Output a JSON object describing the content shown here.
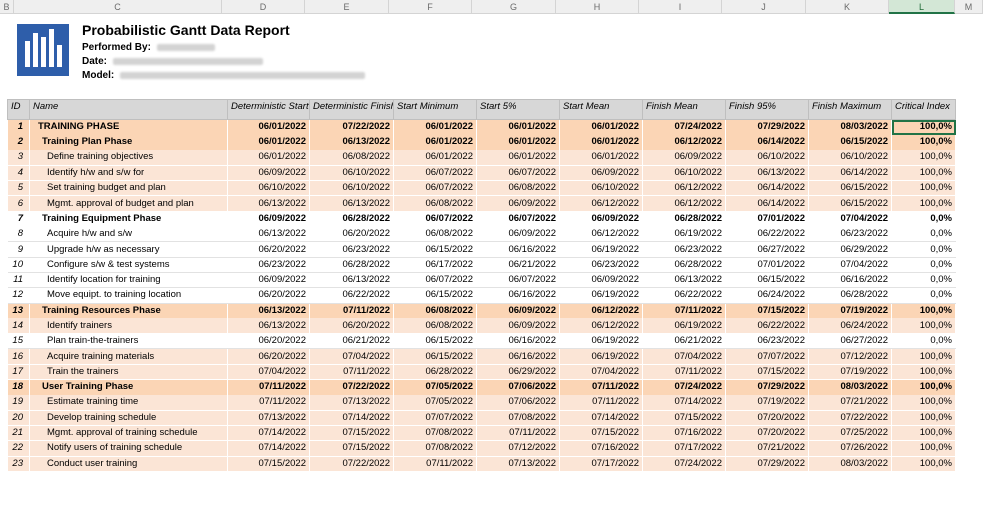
{
  "col_letters": [
    "B",
    "C",
    "D",
    "E",
    "F",
    "G",
    "H",
    "I",
    "J",
    "K",
    "L",
    "M"
  ],
  "report": {
    "title": "Probabilistic Gantt Data Report",
    "performed_by_label": "Performed By:",
    "date_label": "Date:",
    "model_label": "Model:"
  },
  "columns": [
    "ID",
    "Name",
    "Deterministic Start",
    "Deterministic Finish",
    "Start Minimum",
    "Start 5%",
    "Start Mean",
    "Finish Mean",
    "Finish 95%",
    "Finish Maximum",
    "Critical Index"
  ],
  "rows": [
    {
      "id": "1",
      "name": "TRAINING PHASE",
      "ds": "06/01/2022",
      "df": "07/22/2022",
      "smin": "06/01/2022",
      "s5": "06/01/2022",
      "smean": "06/01/2022",
      "fmean": "07/24/2022",
      "f95": "07/29/2022",
      "fmax": "08/03/2022",
      "ci": "100,0%"
    },
    {
      "id": "2",
      "name": "Training Plan Phase",
      "ds": "06/01/2022",
      "df": "06/13/2022",
      "smin": "06/01/2022",
      "s5": "06/01/2022",
      "smean": "06/01/2022",
      "fmean": "06/12/2022",
      "f95": "06/14/2022",
      "fmax": "06/15/2022",
      "ci": "100,0%"
    },
    {
      "id": "3",
      "name": "Define training objectives",
      "ds": "06/01/2022",
      "df": "06/08/2022",
      "smin": "06/01/2022",
      "s5": "06/01/2022",
      "smean": "06/01/2022",
      "fmean": "06/09/2022",
      "f95": "06/10/2022",
      "fmax": "06/10/2022",
      "ci": "100,0%"
    },
    {
      "id": "4",
      "name": "Identify h/w and s/w for",
      "ds": "06/09/2022",
      "df": "06/10/2022",
      "smin": "06/07/2022",
      "s5": "06/07/2022",
      "smean": "06/09/2022",
      "fmean": "06/10/2022",
      "f95": "06/13/2022",
      "fmax": "06/14/2022",
      "ci": "100,0%"
    },
    {
      "id": "5",
      "name": "Set training budget and plan",
      "ds": "06/10/2022",
      "df": "06/10/2022",
      "smin": "06/07/2022",
      "s5": "06/08/2022",
      "smean": "06/10/2022",
      "fmean": "06/12/2022",
      "f95": "06/14/2022",
      "fmax": "06/15/2022",
      "ci": "100,0%"
    },
    {
      "id": "6",
      "name": "Mgmt. approval of budget and plan",
      "ds": "06/13/2022",
      "df": "06/13/2022",
      "smin": "06/08/2022",
      "s5": "06/09/2022",
      "smean": "06/12/2022",
      "fmean": "06/12/2022",
      "f95": "06/14/2022",
      "fmax": "06/15/2022",
      "ci": "100,0%"
    },
    {
      "id": "7",
      "name": "Training Equipment Phase",
      "ds": "06/09/2022",
      "df": "06/28/2022",
      "smin": "06/07/2022",
      "s5": "06/07/2022",
      "smean": "06/09/2022",
      "fmean": "06/28/2022",
      "f95": "07/01/2022",
      "fmax": "07/04/2022",
      "ci": "0,0%"
    },
    {
      "id": "8",
      "name": "Acquire h/w and s/w",
      "ds": "06/13/2022",
      "df": "06/20/2022",
      "smin": "06/08/2022",
      "s5": "06/09/2022",
      "smean": "06/12/2022",
      "fmean": "06/19/2022",
      "f95": "06/22/2022",
      "fmax": "06/23/2022",
      "ci": "0,0%"
    },
    {
      "id": "9",
      "name": "Upgrade h/w as necessary",
      "ds": "06/20/2022",
      "df": "06/23/2022",
      "smin": "06/15/2022",
      "s5": "06/16/2022",
      "smean": "06/19/2022",
      "fmean": "06/23/2022",
      "f95": "06/27/2022",
      "fmax": "06/29/2022",
      "ci": "0,0%"
    },
    {
      "id": "10",
      "name": "Configure s/w & test systems",
      "ds": "06/23/2022",
      "df": "06/28/2022",
      "smin": "06/17/2022",
      "s5": "06/21/2022",
      "smean": "06/23/2022",
      "fmean": "06/28/2022",
      "f95": "07/01/2022",
      "fmax": "07/04/2022",
      "ci": "0,0%"
    },
    {
      "id": "11",
      "name": "Identify location for training",
      "ds": "06/09/2022",
      "df": "06/13/2022",
      "smin": "06/07/2022",
      "s5": "06/07/2022",
      "smean": "06/09/2022",
      "fmean": "06/13/2022",
      "f95": "06/15/2022",
      "fmax": "06/16/2022",
      "ci": "0,0%"
    },
    {
      "id": "12",
      "name": "Move equipt. to training location",
      "ds": "06/20/2022",
      "df": "06/22/2022",
      "smin": "06/15/2022",
      "s5": "06/16/2022",
      "smean": "06/19/2022",
      "fmean": "06/22/2022",
      "f95": "06/24/2022",
      "fmax": "06/28/2022",
      "ci": "0,0%"
    },
    {
      "id": "13",
      "name": "Training Resources Phase",
      "ds": "06/13/2022",
      "df": "07/11/2022",
      "smin": "06/08/2022",
      "s5": "06/09/2022",
      "smean": "06/12/2022",
      "fmean": "07/11/2022",
      "f95": "07/15/2022",
      "fmax": "07/19/2022",
      "ci": "100,0%"
    },
    {
      "id": "14",
      "name": "Identify trainers",
      "ds": "06/13/2022",
      "df": "06/20/2022",
      "smin": "06/08/2022",
      "s5": "06/09/2022",
      "smean": "06/12/2022",
      "fmean": "06/19/2022",
      "f95": "06/22/2022",
      "fmax": "06/24/2022",
      "ci": "100,0%"
    },
    {
      "id": "15",
      "name": "Plan train-the-trainers",
      "ds": "06/20/2022",
      "df": "06/21/2022",
      "smin": "06/15/2022",
      "s5": "06/16/2022",
      "smean": "06/19/2022",
      "fmean": "06/21/2022",
      "f95": "06/23/2022",
      "fmax": "06/27/2022",
      "ci": "0,0%"
    },
    {
      "id": "16",
      "name": "Acquire training materials",
      "ds": "06/20/2022",
      "df": "07/04/2022",
      "smin": "06/15/2022",
      "s5": "06/16/2022",
      "smean": "06/19/2022",
      "fmean": "07/04/2022",
      "f95": "07/07/2022",
      "fmax": "07/12/2022",
      "ci": "100,0%"
    },
    {
      "id": "17",
      "name": "Train the trainers",
      "ds": "07/04/2022",
      "df": "07/11/2022",
      "smin": "06/28/2022",
      "s5": "06/29/2022",
      "smean": "07/04/2022",
      "fmean": "07/11/2022",
      "f95": "07/15/2022",
      "fmax": "07/19/2022",
      "ci": "100,0%"
    },
    {
      "id": "18",
      "name": "User Training Phase",
      "ds": "07/11/2022",
      "df": "07/22/2022",
      "smin": "07/05/2022",
      "s5": "07/06/2022",
      "smean": "07/11/2022",
      "fmean": "07/24/2022",
      "f95": "07/29/2022",
      "fmax": "08/03/2022",
      "ci": "100,0%"
    },
    {
      "id": "19",
      "name": "Estimate training time",
      "ds": "07/11/2022",
      "df": "07/13/2022",
      "smin": "07/05/2022",
      "s5": "07/06/2022",
      "smean": "07/11/2022",
      "fmean": "07/14/2022",
      "f95": "07/19/2022",
      "fmax": "07/21/2022",
      "ci": "100,0%"
    },
    {
      "id": "20",
      "name": "Develop training schedule",
      "ds": "07/13/2022",
      "df": "07/14/2022",
      "smin": "07/07/2022",
      "s5": "07/08/2022",
      "smean": "07/14/2022",
      "fmean": "07/15/2022",
      "f95": "07/20/2022",
      "fmax": "07/22/2022",
      "ci": "100,0%"
    },
    {
      "id": "21",
      "name": "Mgmt. approval of training schedule",
      "ds": "07/14/2022",
      "df": "07/15/2022",
      "smin": "07/08/2022",
      "s5": "07/11/2022",
      "smean": "07/15/2022",
      "fmean": "07/16/2022",
      "f95": "07/20/2022",
      "fmax": "07/25/2022",
      "ci": "100,0%"
    },
    {
      "id": "22",
      "name": "Notify users of training schedule",
      "ds": "07/14/2022",
      "df": "07/15/2022",
      "smin": "07/08/2022",
      "s5": "07/12/2022",
      "smean": "07/16/2022",
      "fmean": "07/17/2022",
      "f95": "07/21/2022",
      "fmax": "07/26/2022",
      "ci": "100,0%"
    },
    {
      "id": "23",
      "name": "Conduct user training",
      "ds": "07/15/2022",
      "df": "07/22/2022",
      "smin": "07/11/2022",
      "s5": "07/13/2022",
      "smean": "07/17/2022",
      "fmean": "07/24/2022",
      "f95": "07/29/2022",
      "fmax": "08/03/2022",
      "ci": "100,0%"
    }
  ],
  "colors": {
    "phase_row": "#fbd5b5",
    "task_row": "#fbe5d6",
    "header": "#d7d7d7",
    "logo": "#2e5eaa",
    "selection": "#217346"
  }
}
